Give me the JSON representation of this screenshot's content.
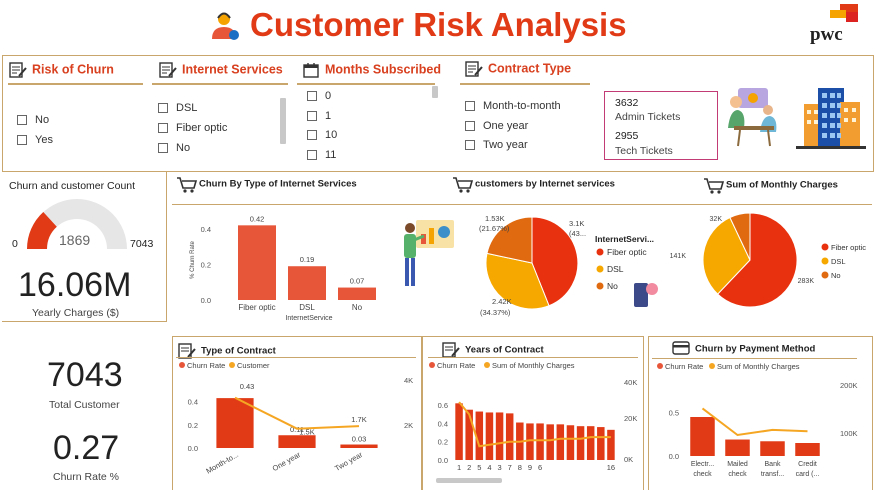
{
  "header": {
    "title": "Customer Risk Analysis",
    "brand": "pwc"
  },
  "slicers": {
    "churn": {
      "title": "Risk of Churn",
      "options": [
        "No",
        "Yes"
      ]
    },
    "internet": {
      "title": "Internet Services",
      "options": [
        "DSL",
        "Fiber optic",
        "No"
      ]
    },
    "months": {
      "title": "Months Subscribed",
      "options": [
        "0",
        "1",
        "10",
        "11"
      ]
    },
    "contract": {
      "title": "Contract Type",
      "options": [
        "Month-to-month",
        "One year",
        "Two year"
      ]
    }
  },
  "tickets": {
    "admin_value": "3632",
    "admin_label": "Admin Tickets",
    "tech_value": "2955",
    "tech_label": "Tech Tickets"
  },
  "kpi": {
    "gauge_title": "Churn and customer Count",
    "gauge_min": "0",
    "gauge_value": "1869",
    "gauge_max": "7043",
    "gauge_fraction": 0.265,
    "yearly_value": "16.06M",
    "yearly_label": "Yearly Charges ($)",
    "total_value": "7043",
    "total_label": "Total Customer",
    "rate_value": "0.27",
    "rate_label": "Churn Rate %"
  },
  "colors": {
    "accent": "#e03a16",
    "orange": "#f4a300",
    "bar": "#e8563a",
    "line": "#f5a623",
    "gold": "#c9a66b"
  },
  "chart_data": [
    {
      "id": "churn-internet",
      "type": "bar",
      "title": "Churn By Type of Internet Services",
      "categories": [
        "Fiber optic",
        "DSL",
        "No"
      ],
      "values": [
        0.42,
        0.19,
        0.07
      ],
      "value_labels": [
        "0.42",
        "0.19",
        "0.07"
      ],
      "xlabel": "InternetService",
      "ylabel": "% Churn Rate",
      "ylim": [
        0,
        0.45
      ],
      "yticks": [
        "0.0",
        "0.2",
        "0.4"
      ]
    },
    {
      "id": "customers-internet",
      "type": "pie",
      "title": "customers by Internet services",
      "legend_title": "InternetServi...",
      "categories": [
        "Fiber optic",
        "DSL",
        "No"
      ],
      "values": [
        3096,
        2421,
        1526
      ],
      "labels": [
        "3.1K",
        "2.42K",
        "1.53K"
      ],
      "pct_labels": [
        "(43...",
        "(34.37%)",
        "(21.67%)"
      ],
      "colors": [
        "#e8320f",
        "#f6a800",
        "#e06a10"
      ]
    },
    {
      "id": "monthly-charges",
      "type": "pie",
      "title": "Sum of Monthly Charges",
      "categories": [
        "Fiber optic",
        "DSL",
        "No"
      ],
      "values": [
        283,
        141,
        32
      ],
      "labels": [
        "283K",
        "141K",
        "32K"
      ],
      "colors": [
        "#e8320f",
        "#f6a800",
        "#e06a10"
      ]
    },
    {
      "id": "type-contract",
      "type": "bar",
      "title": "Type of Contract",
      "legend": [
        "Churn Rate",
        "Customer"
      ],
      "categories": [
        "Month-to...",
        "One year",
        "Two year"
      ],
      "values": [
        0.43,
        0.11,
        0.03
      ],
      "line_values": [
        3.9,
        1.5,
        1.7
      ],
      "value_labels": [
        "0.43",
        "0.11",
        "0.03"
      ],
      "line_labels": [
        "",
        "1.5K",
        "1.7K"
      ],
      "ylim": [
        0,
        0.5
      ],
      "yticks": [
        "0.0",
        "0.2",
        "0.4"
      ],
      "y2ticks": [
        "2K",
        "4K"
      ]
    },
    {
      "id": "years-contract",
      "type": "bar",
      "title": "Years of Contract",
      "legend": [
        "Churn Rate",
        "Sum of Monthly Charges"
      ],
      "categories": [
        "1",
        "2",
        "5",
        "4",
        "3",
        "7",
        "8",
        "9",
        "6",
        "",
        "",
        "",
        "",
        "",
        "",
        "16"
      ],
      "values": [
        0.62,
        0.55,
        0.53,
        0.52,
        0.52,
        0.51,
        0.41,
        0.4,
        0.4,
        0.39,
        0.39,
        0.38,
        0.37,
        0.37,
        0.36,
        0.33
      ],
      "line_values": [
        38,
        30,
        9,
        10,
        11,
        12,
        12,
        13,
        13,
        13,
        14,
        14,
        14,
        15,
        15,
        15
      ],
      "ylim": [
        0,
        0.7
      ],
      "yticks": [
        "0.0",
        "0.2",
        "0.4",
        "0.6"
      ],
      "y2ticks": [
        "0K",
        "20K",
        "40K"
      ]
    },
    {
      "id": "payment-method",
      "type": "bar",
      "title": "Churn by Payment Method",
      "legend": [
        "Churn Rate",
        "Sum of Monthly Charges"
      ],
      "categories": [
        "Electr... check",
        "Mailed check",
        "Bank transf...",
        "Credit card (..."
      ],
      "values": [
        0.45,
        0.19,
        0.17,
        0.15
      ],
      "line_values": [
        215,
        95,
        118,
        112
      ],
      "ylim": [
        0,
        0.6
      ],
      "yticks": [
        "0.0",
        "0.5"
      ],
      "y2ticks": [
        "100K",
        "200K"
      ]
    }
  ]
}
